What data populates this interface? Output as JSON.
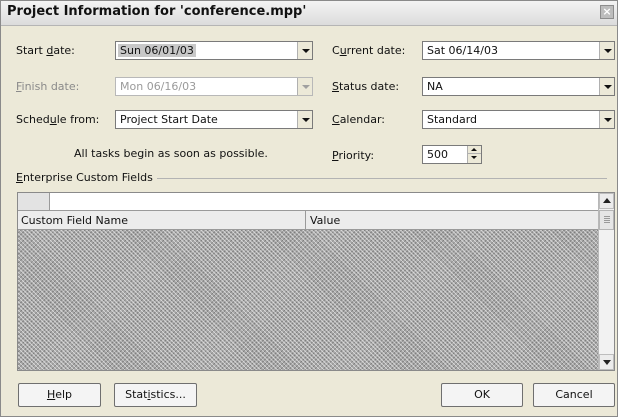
{
  "dialog": {
    "title": "Project Information for 'conference.mpp'",
    "close_glyph": "×"
  },
  "fields": {
    "start_date": {
      "label_pre": "Start ",
      "label_key": "d",
      "label_post": "ate:",
      "value": "Sun 06/01/03"
    },
    "finish_date": {
      "label_pre": "",
      "label_key": "F",
      "label_post": "inish date:",
      "value": "Mon 06/16/03"
    },
    "schedule_from": {
      "label_pre": "Sched",
      "label_key": "u",
      "label_post": "le from:",
      "value": "Project Start Date"
    },
    "schedule_note": "All tasks begin as soon as possible.",
    "current_date": {
      "label_pre": "C",
      "label_key": "u",
      "label_post": "rrent date:",
      "value": "Sat 06/14/03"
    },
    "status_date": {
      "label_pre": "",
      "label_key": "S",
      "label_post": "tatus date:",
      "value": "NA"
    },
    "calendar": {
      "label_pre": "",
      "label_key": "C",
      "label_post": "alendar:",
      "value": "Standard"
    },
    "priority": {
      "label_pre": "",
      "label_key": "P",
      "label_post": "riority:",
      "value": "500"
    }
  },
  "enterprise": {
    "label_key": "E",
    "label_post": "nterprise Custom Fields",
    "columns": [
      "Custom Field Name",
      "Value"
    ]
  },
  "buttons": {
    "help": {
      "pre": "",
      "key": "H",
      "post": "elp"
    },
    "statistics": {
      "pre": "Stat",
      "key": "i",
      "post": "stics..."
    },
    "ok": "OK",
    "cancel": "Cancel"
  }
}
